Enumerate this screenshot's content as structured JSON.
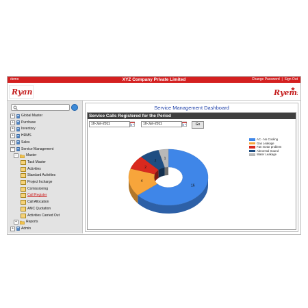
{
  "topbar": {
    "user": "demo",
    "company": "XYZ Company Private Limited",
    "change_password": "Change Password",
    "separator": "|",
    "sign_out": "Sign Out"
  },
  "logos": {
    "left": "Ryan",
    "right": "Ryems"
  },
  "sidebar": {
    "search_value": "",
    "items": [
      {
        "label": "Global Master",
        "level": 0,
        "type": "module",
        "expander": "+"
      },
      {
        "label": "Purchase",
        "level": 0,
        "type": "module",
        "expander": "+"
      },
      {
        "label": "Inventory",
        "level": 0,
        "type": "module",
        "expander": "+"
      },
      {
        "label": "HRMS",
        "level": 0,
        "type": "module",
        "expander": "+"
      },
      {
        "label": "Sales",
        "level": 0,
        "type": "module",
        "expander": "+"
      },
      {
        "label": "Service Management",
        "level": 0,
        "type": "module",
        "expander": "−"
      },
      {
        "label": "Master",
        "level": 1,
        "type": "folder",
        "expander": "−"
      },
      {
        "label": "Task Master",
        "level": 2,
        "type": "leaf"
      },
      {
        "label": "Activities",
        "level": 2,
        "type": "leaf"
      },
      {
        "label": "Standard Activities",
        "level": 2,
        "type": "leaf"
      },
      {
        "label": "Project Incharge",
        "level": 2,
        "type": "leaf"
      },
      {
        "label": "Comissioning",
        "level": 2,
        "type": "leaf"
      },
      {
        "label": "Call Register",
        "level": 2,
        "type": "leaf",
        "active": true
      },
      {
        "label": "Call Allocation",
        "level": 2,
        "type": "leaf"
      },
      {
        "label": "AMC Quotation",
        "level": 2,
        "type": "leaf"
      },
      {
        "label": "Activities Carried Out",
        "level": 2,
        "type": "leaf"
      },
      {
        "label": "Reports",
        "level": 1,
        "type": "folder",
        "expander": "+"
      },
      {
        "label": "Admin",
        "level": 0,
        "type": "module",
        "expander": "+"
      }
    ]
  },
  "dashboard": {
    "title": "Service Management Dashboard",
    "panel_title": "Service Calls Registered for the Period",
    "from_date": "10-Jun-2011",
    "to_date": "10-Jun-2011",
    "go_label": "Go"
  },
  "chart_data": {
    "type": "pie",
    "style": "3d-donut",
    "legend_position": "right",
    "series": [
      {
        "name": "AC - No Cooling",
        "value": 16,
        "color": "#3f86e8"
      },
      {
        "name": "Gas Leakage",
        "value": 4,
        "color": "#f7a53b"
      },
      {
        "name": "Fan motor problem",
        "value": 2,
        "color": "#d9291e"
      },
      {
        "name": "Abnormal Sound",
        "value": 2,
        "color": "#1f4e82"
      },
      {
        "name": "Water Leakage",
        "value": 1,
        "color": "#b8b8b8"
      }
    ]
  }
}
